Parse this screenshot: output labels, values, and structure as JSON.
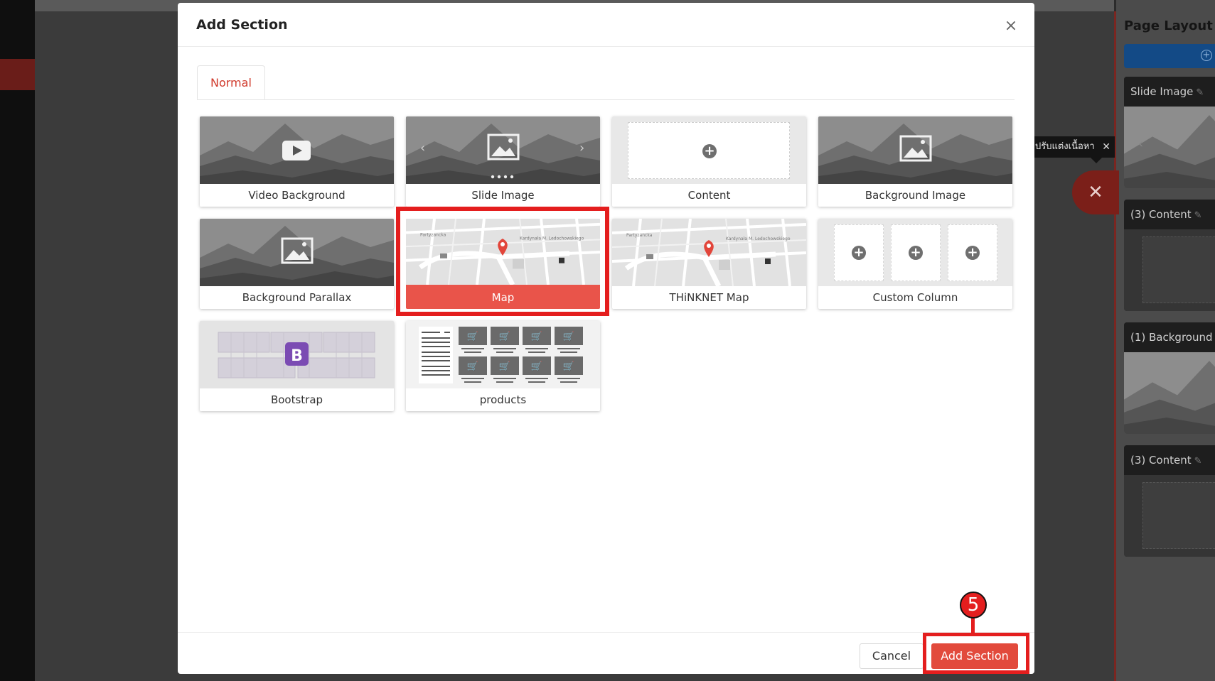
{
  "right_panel": {
    "title": "Page Layout",
    "help_icon": "?",
    "cards": [
      {
        "title": "Slide Image"
      },
      {
        "title": "(3)  Content"
      },
      {
        "title": "(1)  Background"
      },
      {
        "title": "(3)  Content"
      }
    ]
  },
  "tooltip": {
    "text": "ปรับแต่งเนื้อหา",
    "close": "✕"
  },
  "float_close": "✕",
  "modal": {
    "title": "Add Section",
    "close": "×",
    "tabs": [
      {
        "label": "Normal",
        "active": true
      }
    ],
    "tiles": [
      {
        "label": "Video Background"
      },
      {
        "label": "Slide Image"
      },
      {
        "label": "Content"
      },
      {
        "label": "Background Image"
      },
      {
        "label": "Background Parallax"
      },
      {
        "label": "Map",
        "selected": true
      },
      {
        "label": "THiNKNET Map"
      },
      {
        "label": "Custom Column"
      },
      {
        "label": "Bootstrap"
      },
      {
        "label": "products"
      }
    ],
    "footer": {
      "cancel_label": "Cancel",
      "add_label": "Add Section"
    }
  },
  "annotation": {
    "step": "5"
  },
  "colors": {
    "accent": "#e24a3c",
    "highlight": "#e41e1e",
    "bootstrap": "#7b4bb3",
    "panel_button": "#134a86"
  }
}
